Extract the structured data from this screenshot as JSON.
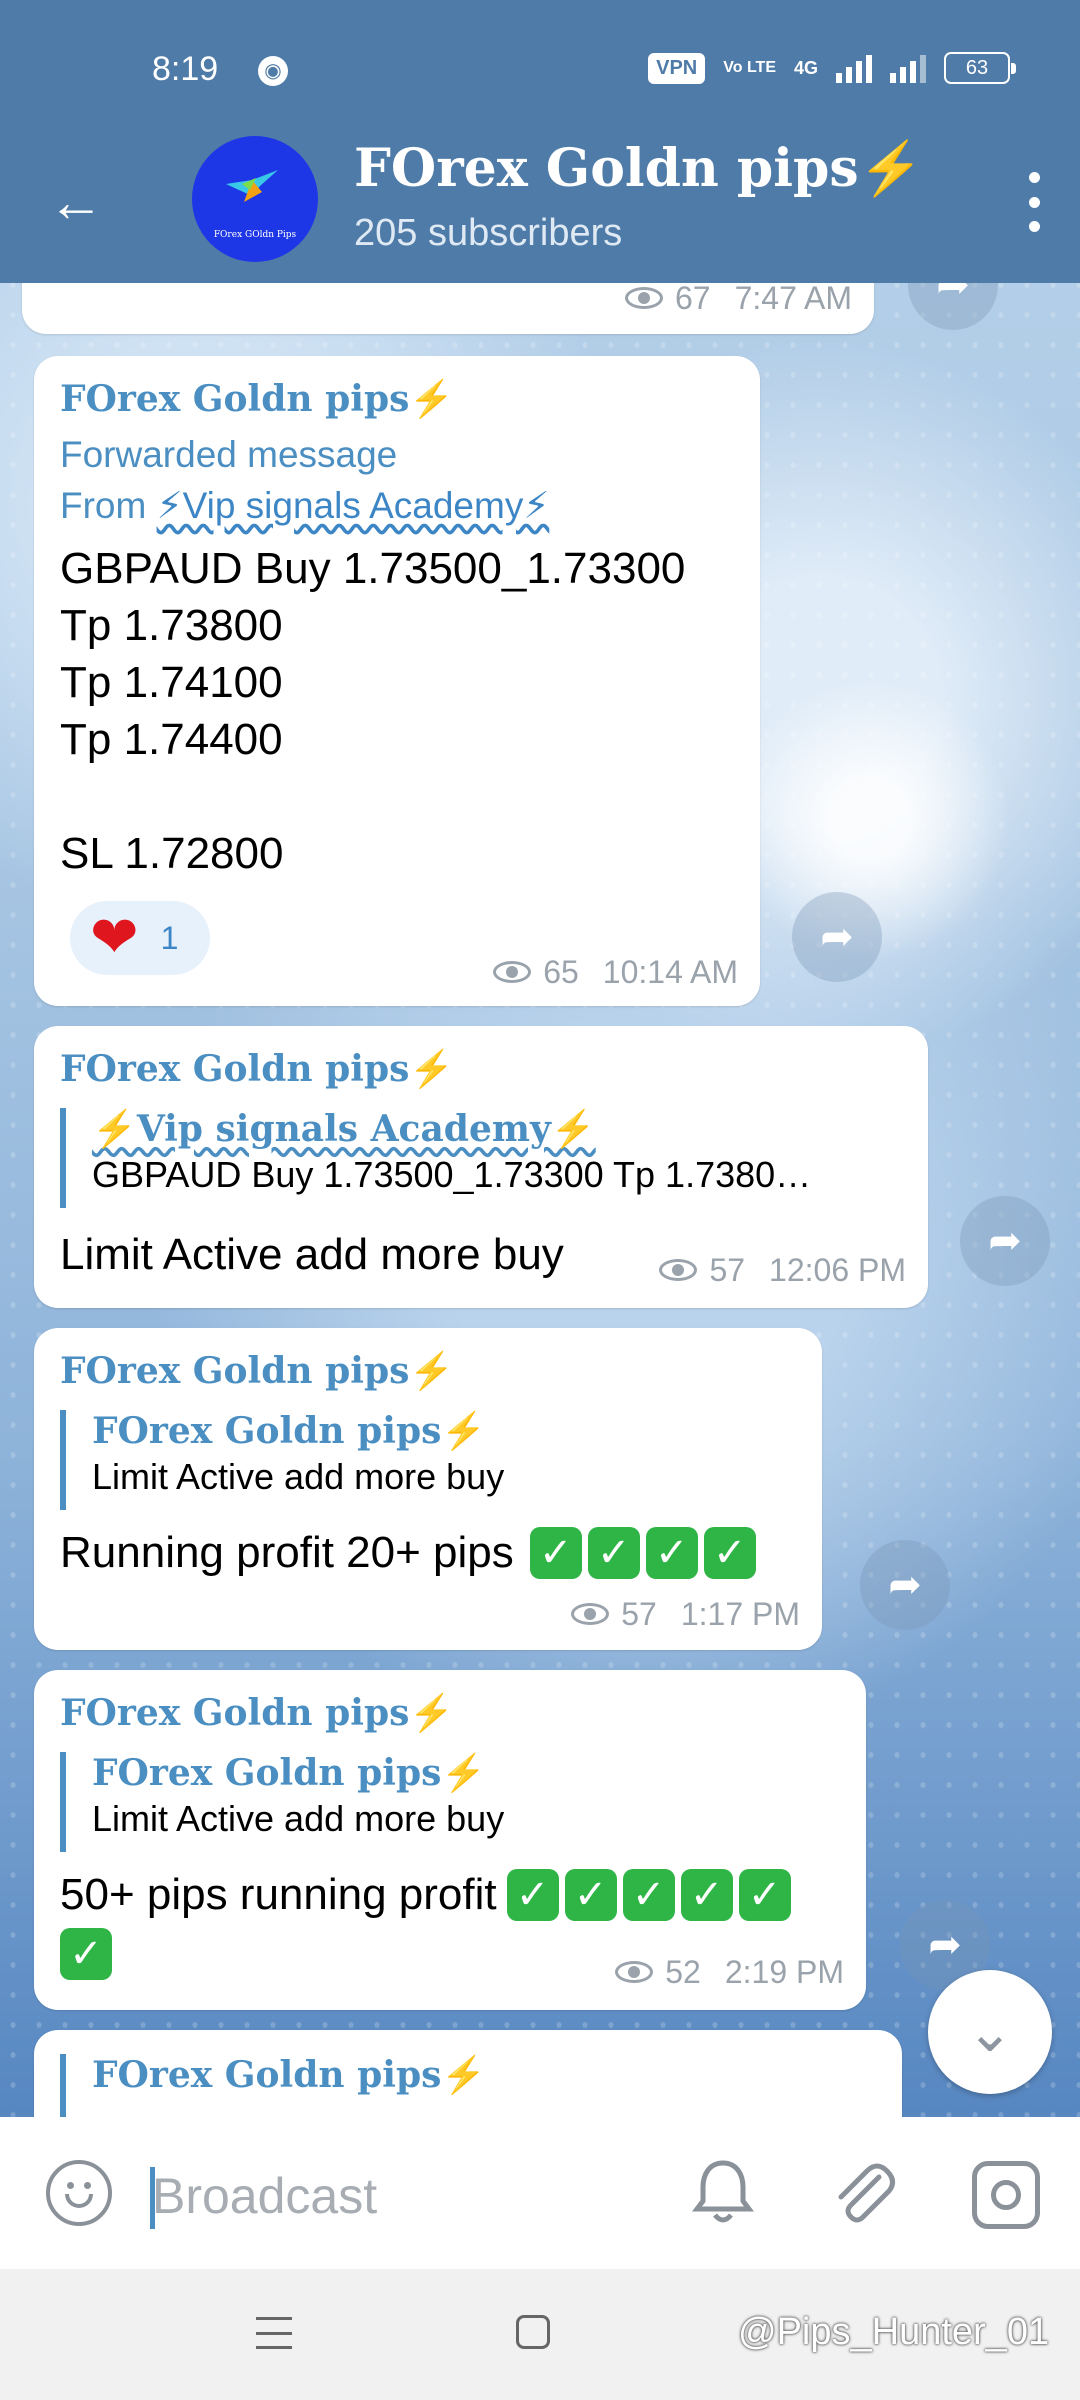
{
  "status_bar": {
    "time": "8:19",
    "vpn": "VPN",
    "volte": "Vo LTE",
    "network": "4G",
    "battery": "63"
  },
  "header": {
    "title": "FOrex Goldn pips⚡",
    "subtitle": "205 subscribers",
    "avatar_text": "FOrex GOldn Pips"
  },
  "messages": [
    {
      "views": "67",
      "time": "7:47 AM"
    },
    {
      "sender": "FOrex Goldn pips⚡",
      "forwarded_label": "Forwarded message",
      "from_label": "From",
      "from_source": "⚡Vip signals Academy⚡",
      "text": "GBPAUD Buy 1.73500_1.73300\nTp 1.73800\nTp 1.74100\nTp 1.74400\n\nSL 1.72800",
      "reaction_emoji": "❤",
      "reaction_count": "1",
      "views": "65",
      "time": "10:14 AM"
    },
    {
      "sender": "FOrex Goldn pips⚡",
      "reply_name": "⚡Vip signals Academy⚡",
      "reply_text": "GBPAUD Buy 1.73500_1.73300 Tp 1.7380…",
      "text": "Limit Active add more buy",
      "views": "57",
      "time": "12:06 PM"
    },
    {
      "sender": "FOrex Goldn pips⚡",
      "reply_name": "FOrex Goldn pips⚡",
      "reply_text": "Limit Active add more buy",
      "text": "Running profit 20+ pips",
      "checks": "✓✓✓✓",
      "views": "57",
      "time": "1:17 PM"
    },
    {
      "sender": "FOrex Goldn pips⚡",
      "reply_name": "FOrex Goldn pips⚡",
      "reply_text": "Limit Active add more buy",
      "text": "50+ pips running profit",
      "checks": "✓✓✓✓✓",
      "checks_line2": "✓",
      "views": "52",
      "time": "2:19 PM"
    },
    {
      "reply_name": "FOrex Goldn pips⚡"
    }
  ],
  "input": {
    "placeholder": "Broadcast"
  },
  "watermark": "@Pips_Hunter_01",
  "colors": {
    "header_bg": "#4f7ba8",
    "accent": "#4a8ec2",
    "check_green": "#2fb546",
    "heart": "#e0161f"
  },
  "icons": [
    "back-arrow-icon",
    "more-vert-icon",
    "eye-icon",
    "share-icon",
    "chevron-down-icon",
    "emoji-icon",
    "bell-icon",
    "paperclip-icon",
    "instagram-icon"
  ]
}
